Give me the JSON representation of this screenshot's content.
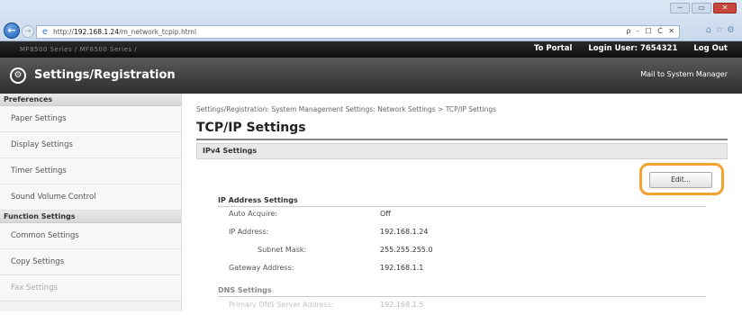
{
  "browser": {
    "url_prefix": "http://",
    "url_host": "192.168.1.24",
    "url_path": "/m_network_tcpip.html",
    "address_tools": "ρ - ☐ Ć ✕",
    "window_buttons": [
      "─",
      "▭",
      "✕"
    ]
  },
  "header": {
    "device_crumb": "MF8500 Series / MF8500 Series /",
    "to_portal": "To Portal",
    "login_user_label": "Login User:",
    "login_user_value": "7654321",
    "logout": "Log Out",
    "title": "Settings/Registration",
    "mail_link": "Mail to System Manager"
  },
  "sidebar": {
    "sections": [
      {
        "heading": "Preferences",
        "items": [
          "Paper Settings",
          "Display Settings",
          "Timer Settings",
          "Sound Volume Control"
        ]
      },
      {
        "heading": "Function Settings",
        "items": [
          "Common Settings",
          "Copy Settings",
          "Fax Settings"
        ]
      }
    ]
  },
  "main": {
    "breadcrumb": "Settings/Registration: System Management Settings: Network Settings > TCP/IP Settings",
    "title": "TCP/IP Settings",
    "section": "IPv4 Settings",
    "edit_label": "Edit...",
    "ip_heading": "IP Address Settings",
    "ip_rows": [
      {
        "key": "Auto Acquire:",
        "value": "Off"
      },
      {
        "key": "IP Address:",
        "value": "192.168.1.24"
      },
      {
        "key": "Subnet Mask:",
        "value": "255.255.255.0"
      },
      {
        "key": "Gateway Address:",
        "value": "192.168.1.1"
      }
    ],
    "dns_heading": "DNS Settings",
    "dns_rows": [
      {
        "key": "Primary DNS Server Address:",
        "value": "192.168.1.5"
      }
    ]
  }
}
